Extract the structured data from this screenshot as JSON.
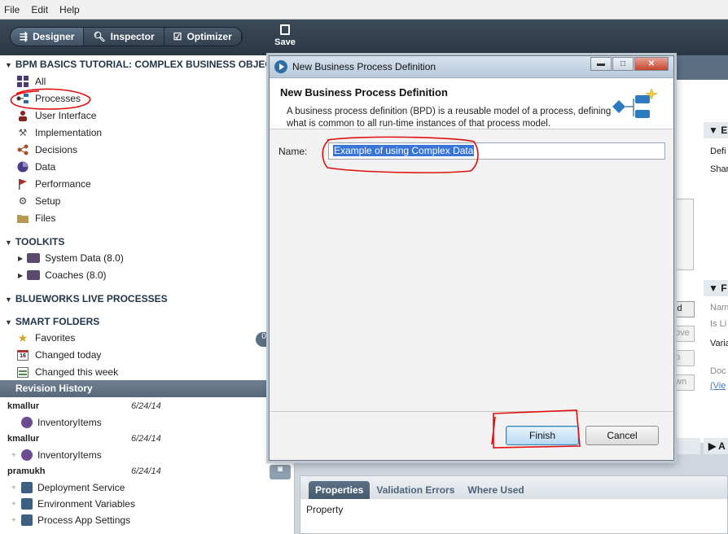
{
  "menu": {
    "file": "File",
    "edit": "Edit",
    "help": "Help"
  },
  "toolbar": {
    "designer": "Designer",
    "inspector": "Inspector",
    "optimizer": "Optimizer",
    "save": "Save"
  },
  "left": {
    "project_title": "BPM BASICS TUTORIAL: COMPLEX BUSINESS OBJECT",
    "items": [
      {
        "label": "All",
        "icon": "grid-icon"
      },
      {
        "label": "Processes",
        "icon": "process-icon"
      },
      {
        "label": "User Interface",
        "icon": "user-icon"
      },
      {
        "label": "Implementation",
        "icon": "wrench-icon"
      },
      {
        "label": "Decisions",
        "icon": "decision-icon"
      },
      {
        "label": "Data",
        "icon": "data-icon"
      },
      {
        "label": "Performance",
        "icon": "flag-icon"
      },
      {
        "label": "Setup",
        "icon": "gear-icon"
      },
      {
        "label": "Files",
        "icon": "folder-icon"
      }
    ],
    "toolkits_title": "TOOLKITS",
    "toolkits": [
      {
        "label": "System Data (8.0)"
      },
      {
        "label": "Coaches (8.0)"
      }
    ],
    "blueworks_title": "BLUEWORKS LIVE PROCESSES",
    "smart_title": "SMART FOLDERS",
    "smart": [
      {
        "label": "Favorites"
      },
      {
        "label": "Changed today",
        "icon_text": "16"
      },
      {
        "label": "Changed this week"
      }
    ],
    "badge_count": "0"
  },
  "revision": {
    "title": "Revision History",
    "entries": [
      {
        "user": "kmallur",
        "date": "6/24/14",
        "item": "InventoryItems"
      },
      {
        "user": "kmallur",
        "date": "6/24/14",
        "item": "InventoryItems"
      },
      {
        "user": "pramukh",
        "date": "6/24/14",
        "items": [
          "Deployment Service",
          "Environment Variables",
          "Process App Settings"
        ]
      }
    ]
  },
  "background": {
    "right_col_top": [
      "Defi",
      "Shar"
    ],
    "right_col_mid": [
      "Nam",
      "Is Li",
      "Varia",
      "Doc",
      "(Vie"
    ],
    "behind_buttons": [
      "ld",
      "ove",
      "p",
      "wn"
    ],
    "tab_labels": [
      "E",
      "F",
      "A"
    ]
  },
  "properties": {
    "tabs": [
      "Properties",
      "Validation Errors",
      "Where Used"
    ],
    "row_label": "Property"
  },
  "dialog": {
    "window_title": "New Business Process Definition",
    "heading": "New Business Process Definition",
    "description": "A business process definition (BPD) is a reusable model of a process, defining what is common to all run-time instances of that process model.",
    "name_label": "Name:",
    "name_value": "Example of using Complex Data",
    "finish": "Finish",
    "cancel": "Cancel",
    "minimize": "▬",
    "maximize": "□",
    "close": "✕"
  }
}
